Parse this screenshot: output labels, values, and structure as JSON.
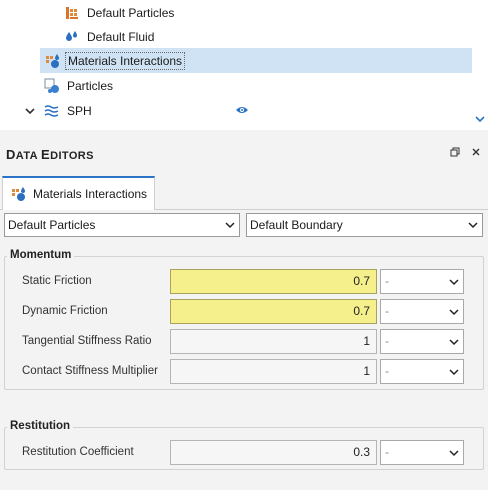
{
  "tree": {
    "items": [
      {
        "label": "Default Particles",
        "icon": "particles-material-icon"
      },
      {
        "label": "Default Fluid",
        "icon": "fluid-drop-icon"
      },
      {
        "label": "Materials Interactions",
        "icon": "materials-interactions-icon",
        "selected": true
      },
      {
        "label": "Particles",
        "icon": "particles-icon"
      },
      {
        "label": "SPH",
        "icon": "sph-waves-icon",
        "expanded": true,
        "visible": true
      }
    ]
  },
  "editors": {
    "title_cap1": "D",
    "title_rest1": "ATA ",
    "title_cap2": "E",
    "title_rest2": "DITORS",
    "tab_label": "Materials Interactions",
    "material_a": "Default Particles",
    "material_b": "Default Boundary",
    "momentum": {
      "title": "Momentum",
      "rows": [
        {
          "label": "Static Friction",
          "value": "0.7",
          "unit": "-",
          "highlighted": true
        },
        {
          "label": "Dynamic Friction",
          "value": "0.7",
          "unit": "-",
          "highlighted": true
        },
        {
          "label": "Tangential Stiffness Ratio",
          "value": "1",
          "unit": "-",
          "highlighted": false
        },
        {
          "label": "Contact Stiffness Multiplier",
          "value": "1",
          "unit": "-",
          "highlighted": false
        }
      ]
    },
    "restitution": {
      "title": "Restitution",
      "rows": [
        {
          "label": "Restitution Coefficient",
          "value": "0.3",
          "unit": "-",
          "highlighted": false
        }
      ]
    }
  },
  "colors": {
    "selection": "#cfe3f5",
    "highlight_field": "#f5ef8c",
    "accent": "#2b73c7"
  }
}
